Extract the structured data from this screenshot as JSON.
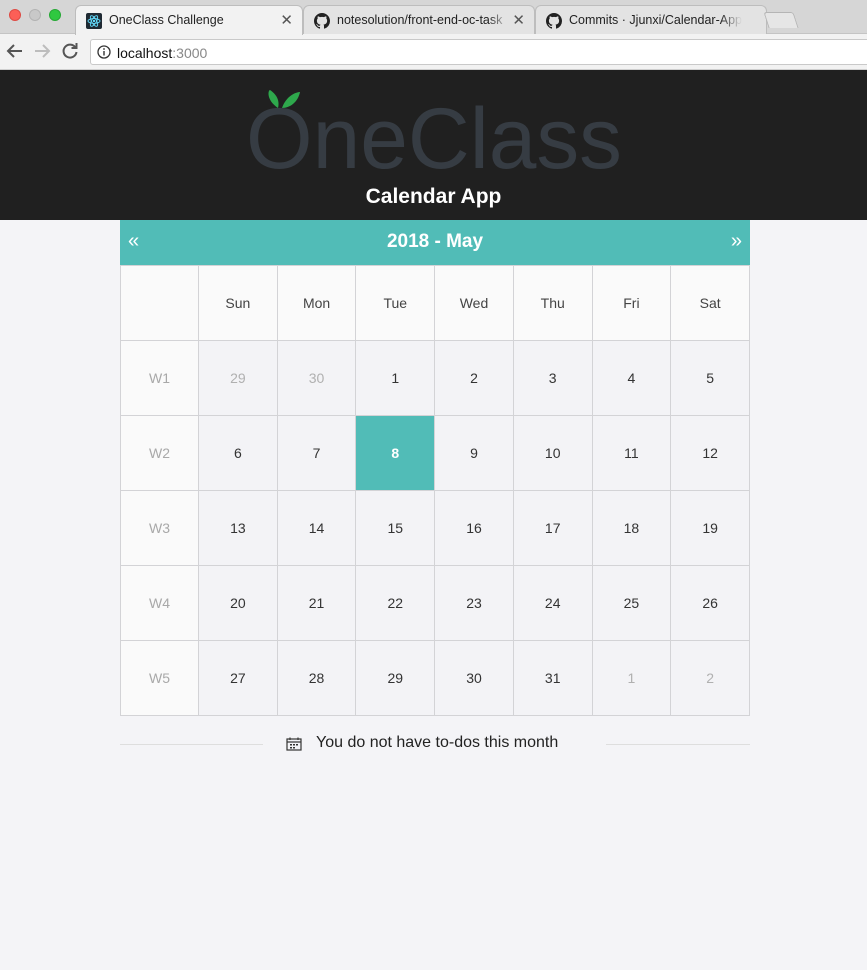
{
  "browser": {
    "tabs": [
      {
        "label": "OneClass Challenge",
        "active": true,
        "icon": "react-icon"
      },
      {
        "label": "notesolution/front-end-oc-task",
        "active": false,
        "icon": "github-icon"
      },
      {
        "label": "Commits · Jjunxi/Calendar-App",
        "active": false,
        "icon": "github-icon"
      }
    ],
    "url_host": "localhost",
    "url_port": ":3000"
  },
  "header": {
    "logo_text": "OneClass",
    "app_title": "Calendar App"
  },
  "calendar": {
    "title": "2018 - May",
    "prev_label": "«",
    "next_label": "»",
    "weekday_headers": [
      "Sun",
      "Mon",
      "Tue",
      "Wed",
      "Thu",
      "Fri",
      "Sat"
    ],
    "weeks": [
      {
        "label": "W1",
        "days": [
          {
            "d": "29",
            "other": true
          },
          {
            "d": "30",
            "other": true
          },
          {
            "d": "1"
          },
          {
            "d": "2"
          },
          {
            "d": "3"
          },
          {
            "d": "4"
          },
          {
            "d": "5"
          }
        ]
      },
      {
        "label": "W2",
        "days": [
          {
            "d": "6"
          },
          {
            "d": "7"
          },
          {
            "d": "8",
            "today": true
          },
          {
            "d": "9"
          },
          {
            "d": "10"
          },
          {
            "d": "11"
          },
          {
            "d": "12"
          }
        ]
      },
      {
        "label": "W3",
        "days": [
          {
            "d": "13"
          },
          {
            "d": "14"
          },
          {
            "d": "15"
          },
          {
            "d": "16"
          },
          {
            "d": "17"
          },
          {
            "d": "18"
          },
          {
            "d": "19"
          }
        ]
      },
      {
        "label": "W4",
        "days": [
          {
            "d": "20"
          },
          {
            "d": "21"
          },
          {
            "d": "22"
          },
          {
            "d": "23"
          },
          {
            "d": "24"
          },
          {
            "d": "25"
          },
          {
            "d": "26"
          }
        ]
      },
      {
        "label": "W5",
        "days": [
          {
            "d": "27"
          },
          {
            "d": "28"
          },
          {
            "d": "29"
          },
          {
            "d": "30"
          },
          {
            "d": "31"
          },
          {
            "d": "1",
            "other": true
          },
          {
            "d": "2",
            "other": true
          }
        ]
      }
    ]
  },
  "todo": {
    "message": "You do not have to-dos this month",
    "icon": "calendar-icon"
  },
  "colors": {
    "accent": "#51bcb7",
    "header_bg": "#202020",
    "page_bg": "#f4f4f7"
  }
}
